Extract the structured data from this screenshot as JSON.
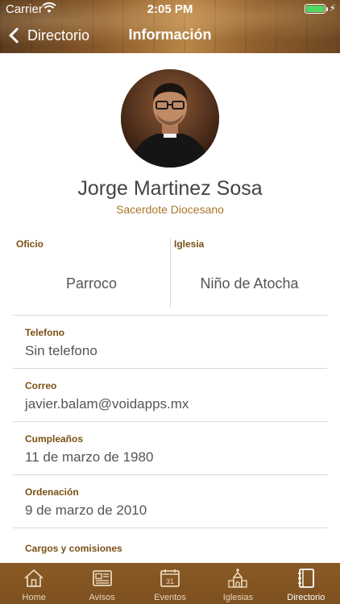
{
  "status_bar": {
    "carrier": "Carrier",
    "time": "2:05 PM"
  },
  "nav": {
    "back_label": "Directorio",
    "title": "Información"
  },
  "profile": {
    "name": "Jorge Martinez Sosa",
    "role": "Sacerdote Diocesano"
  },
  "split": {
    "oficio_label": "Oficio",
    "oficio_value": "Parroco",
    "iglesia_label": "Iglesia",
    "iglesia_value": "Niño de Atocha"
  },
  "details": [
    {
      "label": "Telefono",
      "value": "Sin telefono"
    },
    {
      "label": "Correo",
      "value": "javier.balam@voidapps.mx"
    },
    {
      "label": "Cumpleaños",
      "value": "11 de marzo de 1980"
    },
    {
      "label": "Ordenación",
      "value": "9 de marzo de 2010"
    },
    {
      "label": "Cargos y comisiones",
      "value": ""
    }
  ],
  "tabbar": {
    "items": [
      {
        "label": "Home",
        "icon": "home-icon"
      },
      {
        "label": "Avisos",
        "icon": "newspaper-icon"
      },
      {
        "label": "Eventos",
        "icon": "calendar-icon",
        "calendar_day": "31"
      },
      {
        "label": "Iglesias",
        "icon": "church-icon"
      },
      {
        "label": "Directorio",
        "icon": "address-book-icon"
      }
    ],
    "active_index": 4
  },
  "colors": {
    "accent": "#a9752c",
    "label_brown": "#7a5016",
    "tabbar": "#8a5a24",
    "battery": "#4cd964"
  }
}
